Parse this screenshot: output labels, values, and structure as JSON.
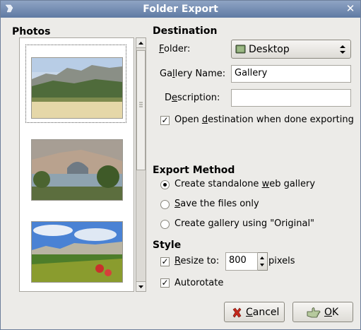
{
  "window": {
    "title": "Folder Export"
  },
  "photos": {
    "heading": "Photos"
  },
  "destination": {
    "heading": "Destination",
    "folder_label_pre": "",
    "folder_label_ul": "F",
    "folder_label_post": "older:",
    "folder_value": "Desktop",
    "gallery_name_label_pre": "Ga",
    "gallery_name_label_ul": "l",
    "gallery_name_label_post": "lery Name:",
    "gallery_name_value": "Gallery",
    "description_label_pre": "D",
    "description_label_ul": "e",
    "description_label_post": "scription:",
    "description_value": "",
    "open_dest_pre": "Open ",
    "open_dest_ul": "d",
    "open_dest_post": "estination when done exporting",
    "open_dest_checked": true
  },
  "export_method": {
    "heading": "Export Method",
    "options": [
      {
        "pre": "Create standalone ",
        "ul": "w",
        "post": "eb gallery",
        "selected": true
      },
      {
        "pre": "",
        "ul": "S",
        "post": "ave the files only",
        "selected": false
      },
      {
        "pre": "Create ",
        "ul": "g",
        "post": "allery using \"Original\"",
        "selected": false
      }
    ]
  },
  "style": {
    "heading": "Style",
    "resize_pre": "",
    "resize_ul": "R",
    "resize_post": "esize to:",
    "resize_checked": true,
    "resize_value": "800",
    "resize_unit": "pixels",
    "autorotate_label": "Autorotate",
    "autorotate_checked": true
  },
  "buttons": {
    "cancel_ul": "C",
    "cancel_post": "ancel",
    "ok_ul": "O",
    "ok_post": "K"
  },
  "icons": {
    "folder": "desktop-folder-icon",
    "combo_arrows": "up-down-arrows-icon",
    "cancel": "cancel-x-icon",
    "ok": "ok-hand-icon"
  }
}
